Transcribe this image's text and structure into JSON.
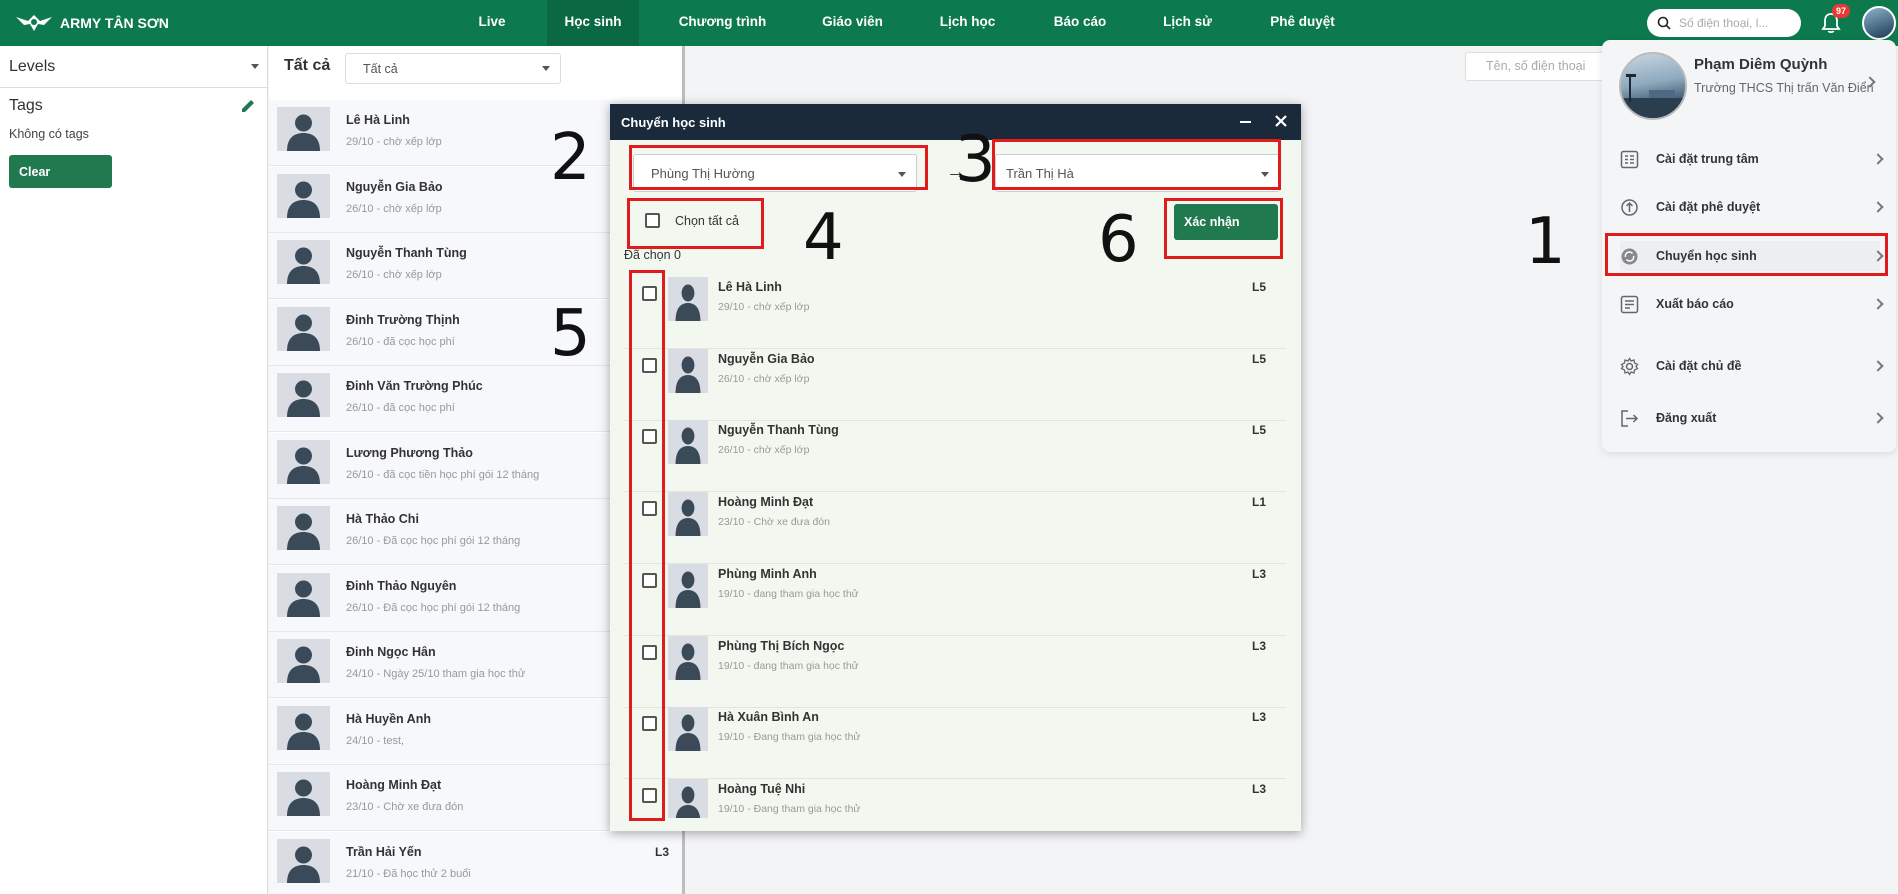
{
  "brand": {
    "name": "ARMY TÂN SƠN"
  },
  "nav": {
    "items": [
      {
        "label": "Live"
      },
      {
        "label": "Học sinh"
      },
      {
        "label": "Chương trình"
      },
      {
        "label": "Giáo viên"
      },
      {
        "label": "Lịch học"
      },
      {
        "label": "Báo cáo"
      },
      {
        "label": "Lịch sử"
      },
      {
        "label": "Phê duyệt"
      }
    ],
    "active": "Học sinh"
  },
  "search": {
    "placeholder": "Số điện thoại, l..."
  },
  "notifications": {
    "count": "97"
  },
  "sidebar": {
    "levels_label": "Levels",
    "tags_title": "Tags",
    "no_tags": "Không có tags",
    "clear_label": "Clear"
  },
  "list": {
    "header": "Tất cả",
    "filter_value": "Tất cả",
    "students": [
      {
        "name": "Lê Hà Linh",
        "status": "29/10 - chờ xếp lớp",
        "level": ""
      },
      {
        "name": "Nguyễn Gia Bảo",
        "status": "26/10 - chờ xếp lớp",
        "level": ""
      },
      {
        "name": "Nguyễn Thanh Tùng",
        "status": "26/10 - chờ xếp lớp",
        "level": ""
      },
      {
        "name": "Đinh Trường Thịnh",
        "status": "26/10 - đã cọc học phí",
        "level": ""
      },
      {
        "name": "Đinh Văn Trường Phúc",
        "status": "26/10 - đã cọc học phí",
        "level": ""
      },
      {
        "name": "Lương Phương Thảo",
        "status": "26/10 - đã cọc tiền học phí gói 12 tháng",
        "level": ""
      },
      {
        "name": "Hà Thảo Chi",
        "status": "26/10 - Đã cọc học phí gói 12 tháng",
        "level": ""
      },
      {
        "name": "Đinh Thảo Nguyên",
        "status": "26/10 - Đã cọc học phí gói 12 tháng",
        "level": ""
      },
      {
        "name": "Đinh Ngọc Hân",
        "status": "24/10 - Ngày 25/10 tham gia học thử",
        "level": ""
      },
      {
        "name": "Hà Huyền Anh",
        "status": "24/10 - test,",
        "level": ""
      },
      {
        "name": "Hoàng Minh Đạt",
        "status": "23/10 - Chờ xe đưa đón",
        "level": ""
      },
      {
        "name": "Trần Hải Yến",
        "status": "21/10 - Đã học thử 2 buổi",
        "level": "L3"
      }
    ]
  },
  "right": {
    "search_placeholder": "Tên, số điện thoại"
  },
  "modal": {
    "title": "Chuyển học sinh",
    "from_teacher": "Phùng Thị Hường",
    "arrow": "→",
    "to_teacher": "Trần Thị Hà",
    "select_all": "Chọn tất cả",
    "confirm": "Xác nhận",
    "selected_count": "Đã chọn 0",
    "students": [
      {
        "name": "Lê Hà Linh",
        "status": "29/10 - chờ xếp lớp",
        "level": "L5"
      },
      {
        "name": "Nguyễn Gia Bảo",
        "status": "26/10 - chờ xếp lớp",
        "level": "L5"
      },
      {
        "name": "Nguyễn Thanh Tùng",
        "status": "26/10 - chờ xếp lớp",
        "level": "L5"
      },
      {
        "name": "Hoàng Minh Đạt",
        "status": "23/10 - Chờ xe đưa đón",
        "level": "L1"
      },
      {
        "name": "Phùng Minh Anh",
        "status": "19/10 - đang tham gia học thử",
        "level": "L3"
      },
      {
        "name": "Phùng Thị Bích Ngọc",
        "status": "19/10 - đang tham gia học thử",
        "level": "L3"
      },
      {
        "name": "Hà Xuân Bình An",
        "status": "19/10 - Đang tham gia học thử",
        "level": "L3"
      },
      {
        "name": "Hoàng Tuệ Nhi",
        "status": "19/10 - Đang tham gia học thử",
        "level": "L3"
      }
    ]
  },
  "profile": {
    "name": "Phạm Diêm Quỳnh",
    "school": "Trường THCS Thị trấn Văn Điển",
    "menu": [
      {
        "label": "Cài đặt trung tâm",
        "icon": "settings-list-icon"
      },
      {
        "label": "Cài đặt phê duyệt",
        "icon": "approval-icon"
      },
      {
        "label": "Chuyển học sinh",
        "icon": "transfer-icon"
      },
      {
        "label": "Xuất báo cáo",
        "icon": "report-icon"
      },
      {
        "label": "Cài đặt chủ đề",
        "icon": "gear-icon"
      },
      {
        "label": "Đăng xuất",
        "icon": "logout-icon"
      }
    ]
  },
  "annotations": {
    "n1": "1",
    "n2": "2",
    "n3": "3",
    "n4": "4",
    "n5": "5",
    "n6": "6"
  },
  "colors": {
    "primary": "#0c7a4e",
    "button": "#217a4f",
    "modal_header": "#1b2a3a",
    "annotation": "#e01b1b"
  }
}
